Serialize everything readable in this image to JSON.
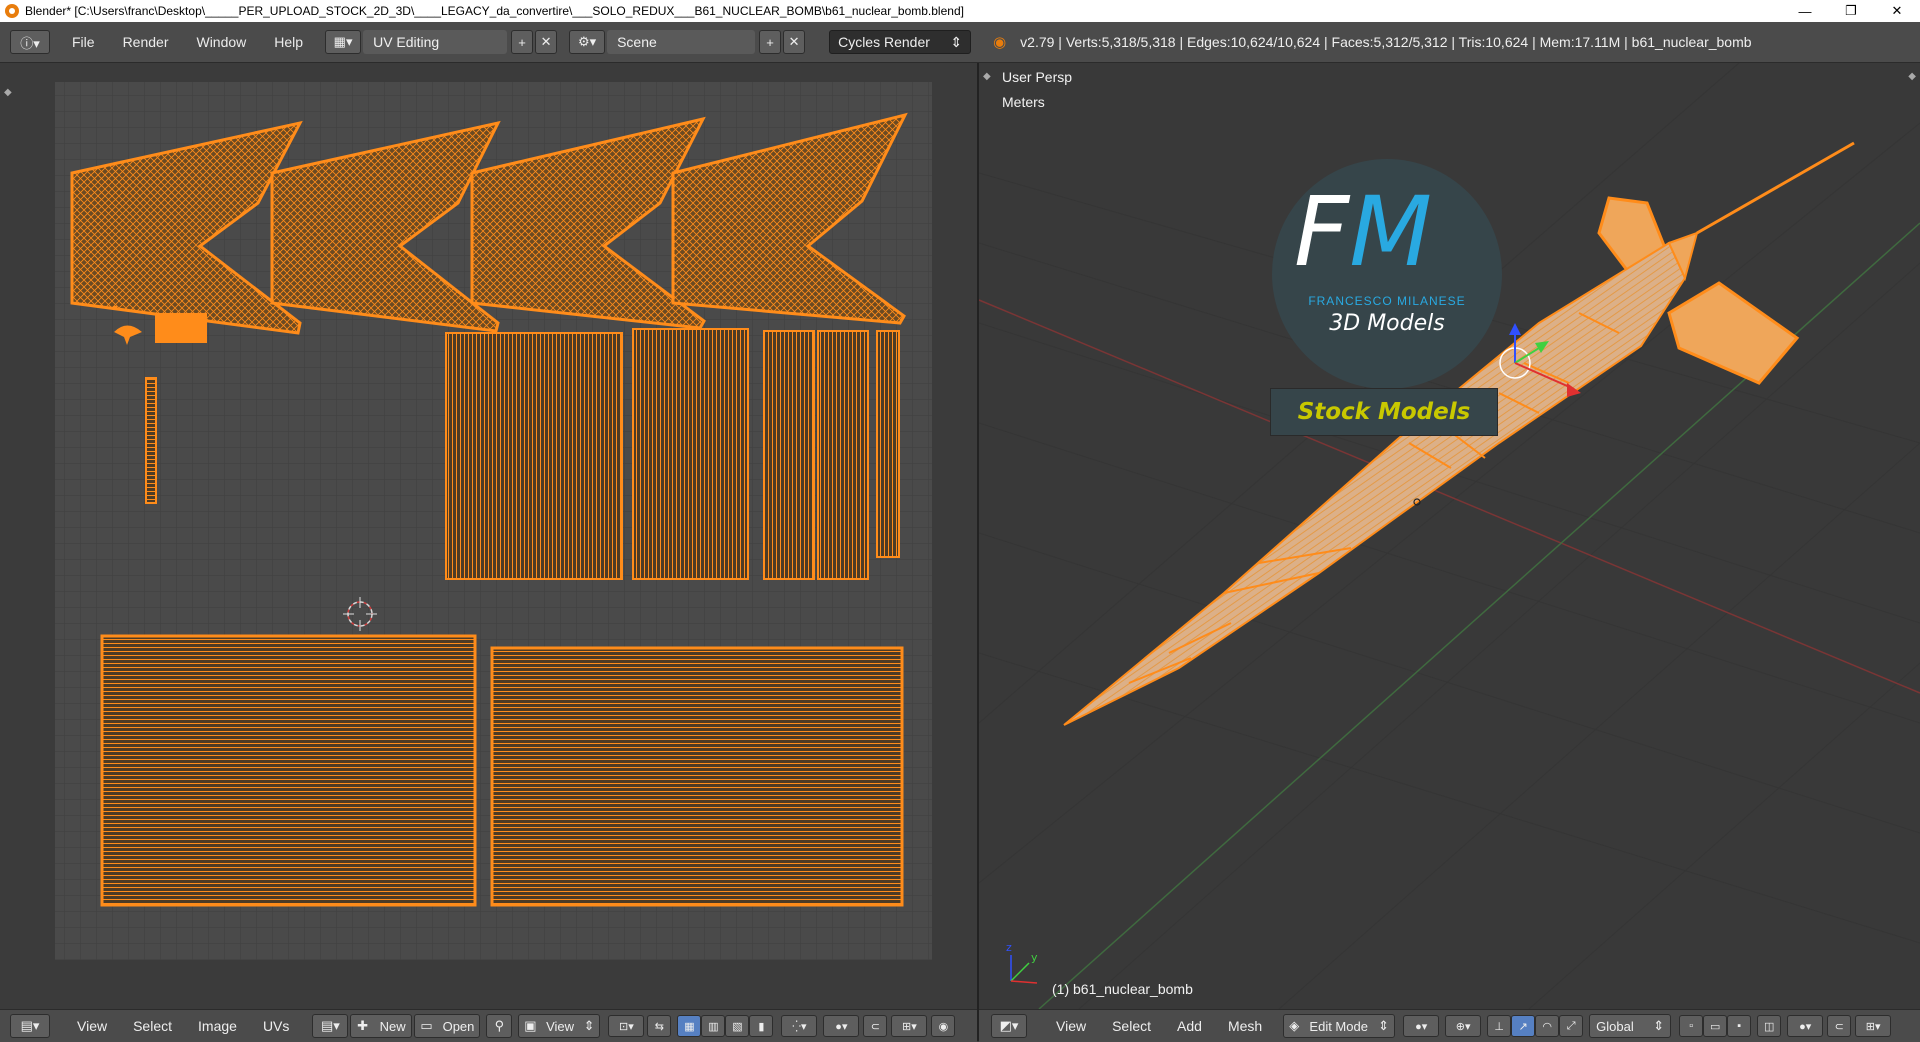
{
  "window": {
    "title": "Blender* [C:\\Users\\franc\\Desktop\\_____PER_UPLOAD_STOCK_2D_3D\\____LEGACY_da_convertire\\___SOLO_REDUX___B61_NUCLEAR_BOMB\\b61_nuclear_bomb.blend]",
    "minimize": "—",
    "restore": "❐",
    "close": "✕"
  },
  "header": {
    "menus": [
      "File",
      "Render",
      "Window",
      "Help"
    ],
    "layout": "UV Editing",
    "scene": "Scene",
    "engine": "Cycles Render",
    "stats": "v2.79 | Verts:5,318/5,318 | Edges:10,624/10,624 | Faces:5,312/5,312 | Tris:10,624 | Mem:17.11M | b61_nuclear_bomb"
  },
  "uv_editor": {
    "menus": [
      "View",
      "Select",
      "Image",
      "UVs"
    ],
    "new_label": "New",
    "open_label": "Open",
    "view_label": "View"
  },
  "viewport": {
    "view_name": "User Persp",
    "units": "Meters",
    "object_label": "(1) b61_nuclear_bomb",
    "menus": [
      "View",
      "Select",
      "Add",
      "Mesh"
    ],
    "mode": "Edit Mode",
    "orientation": "Global"
  },
  "watermark": {
    "initials_f": "F",
    "initials_m": "M",
    "name": "FRANCESCO MILANESE",
    "subtitle": "3D Models",
    "banner": "Stock Models"
  },
  "colors": {
    "uv_orange": "#ff8c1a",
    "selection_orange": "#f5a623",
    "accent_blue": "#29a9e1",
    "banner_yellow": "#c8c800"
  }
}
